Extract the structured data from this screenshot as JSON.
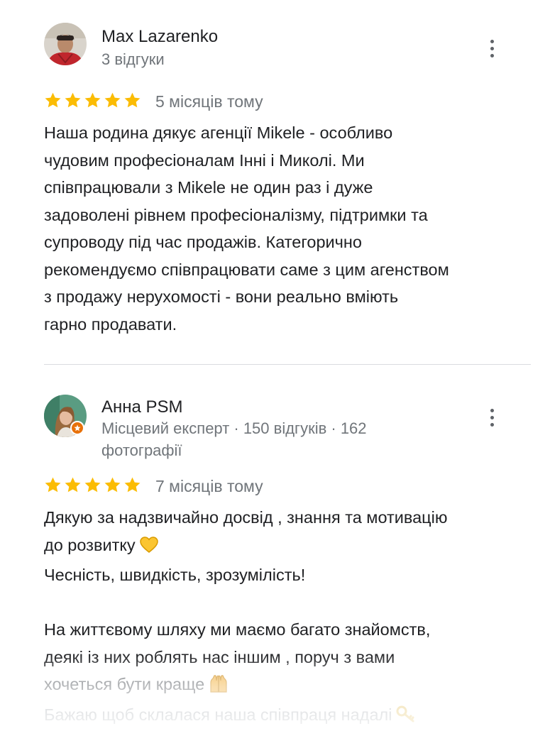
{
  "reviews": [
    {
      "author": "Max Lazarenko",
      "meta": "3 відгуки",
      "rating": 5,
      "time": "5 місяців тому",
      "lines": [
        "Наша родина  дякує агенції  Mikele - особливо",
        "чудовим професіоналам Інні і Миколі.  Ми",
        "співпрацювали з Mikele не один раз і дуже",
        "задоволені рівнем професіоналізму, підтримки та",
        "супроводу під час продажів.  Категорично",
        "рекомендуємо співпрацювати саме з цим агенством",
        "з продажу нерухомості - вони  реально вміють",
        "гарно продавати."
      ]
    },
    {
      "author": "Анна PSM",
      "meta_line1": "Місцевий експерт · 150 відгуків · 162",
      "meta_line2": "фотографії",
      "rating": 5,
      "time": "7 місяців тому",
      "lines": [
        "Дякую за надзвичайно досвід , знання та мотивацію",
        "до розвитку",
        "Чесність, швидкість, зрозумілість!",
        "",
        "На життєвому шляху ми маємо багато знайомств,",
        "деякі із них роблять нас іншим , поруч з вами",
        "хочеться бути краще",
        "Бажаю щоб склалася наша співпраця надалі"
      ]
    }
  ],
  "icons": {
    "star": "star-icon",
    "more": "more-vert-icon",
    "heart": "yellow-heart-emoji",
    "hands": "raising-hands-emoji",
    "key": "key-emoji",
    "local_guide": "local-guide-badge-icon"
  },
  "colors": {
    "star": "#fbbc04",
    "meta": "#70757a",
    "text": "#202124",
    "divider": "#dadce0",
    "badge": "#e8710a"
  }
}
